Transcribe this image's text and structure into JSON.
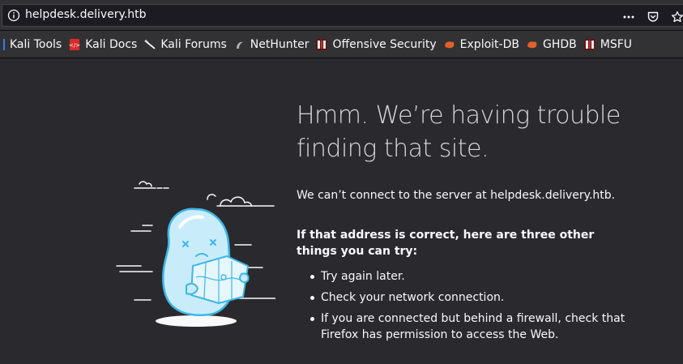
{
  "browser": {
    "url": "helpdesk.delivery.htb",
    "icons": [
      "info-icon",
      "more-actions-icon",
      "pocket-icon",
      "bookmark-star-icon"
    ]
  },
  "bookmarks": [
    {
      "label": "Kali Tools",
      "icon": "kali-icon"
    },
    {
      "label": "Kali Docs",
      "icon": "kali-docs-icon"
    },
    {
      "label": "Kali Forums",
      "icon": "kali-forums-icon"
    },
    {
      "label": "NetHunter",
      "icon": "nethunter-icon"
    },
    {
      "label": "Offensive Security",
      "icon": "offsec-icon"
    },
    {
      "label": "Exploit-DB",
      "icon": "exploit-db-icon"
    },
    {
      "label": "GHDB",
      "icon": "ghdb-icon"
    },
    {
      "label": "MSFU",
      "icon": "msfu-icon"
    }
  ],
  "error_page": {
    "title": "Hmm. We’re having trouble finding that site.",
    "description": "We can’t connect to the server at helpdesk.delivery.htb.",
    "subheading": "If that address is correct, here are three other things you can try:",
    "tips": [
      "Try again later.",
      "Check your network connection.",
      "If you are connected but behind a firewall, check that Firefox has permission to access the Web."
    ]
  }
}
